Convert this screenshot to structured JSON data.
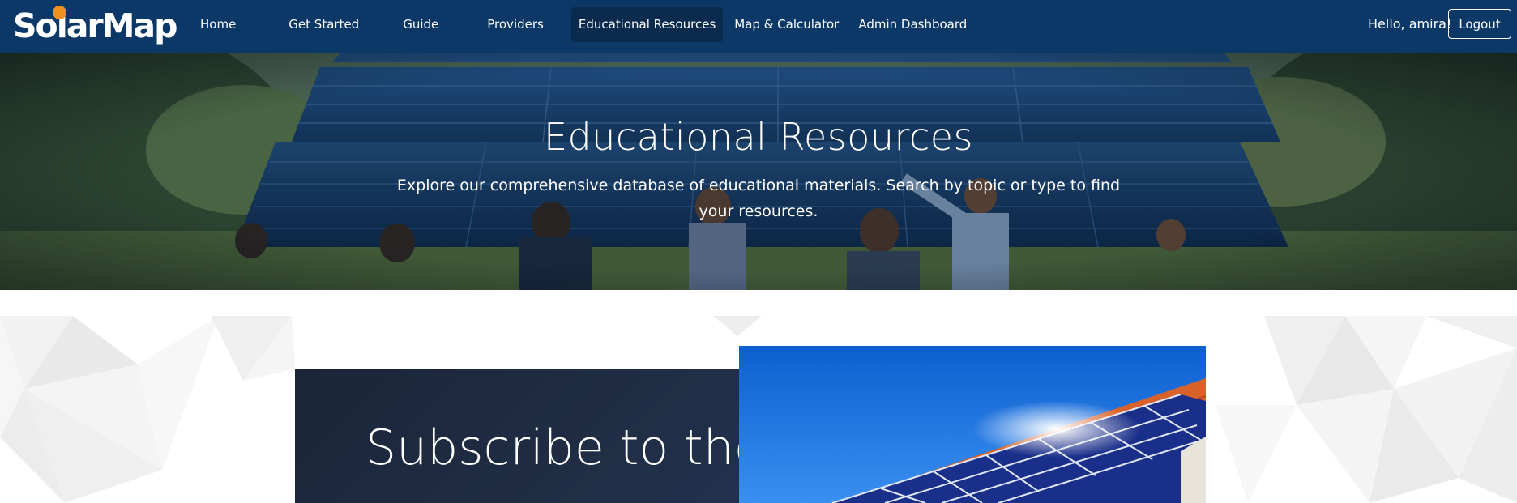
{
  "brand": {
    "name": "SolarMap",
    "accent": "#f0901e",
    "nav_bg": "#0b3866"
  },
  "nav": {
    "items": [
      {
        "label": "Home",
        "active": false
      },
      {
        "label": "Get Started",
        "active": false
      },
      {
        "label": "Guide",
        "active": false
      },
      {
        "label": "Providers",
        "active": false
      },
      {
        "label": "Educational Resources",
        "active": true
      },
      {
        "label": "Map & Calculator",
        "active": false
      },
      {
        "label": "Admin Dashboard",
        "active": false
      }
    ],
    "greeting": "Hello, amira!",
    "logout_label": "Logout"
  },
  "hero": {
    "title": "Educational Resources",
    "subtitle": "Explore our comprehensive database of educational materials. Search by topic or type to find your resources."
  },
  "newsletter": {
    "title": "Subscribe to the Newsletter"
  }
}
